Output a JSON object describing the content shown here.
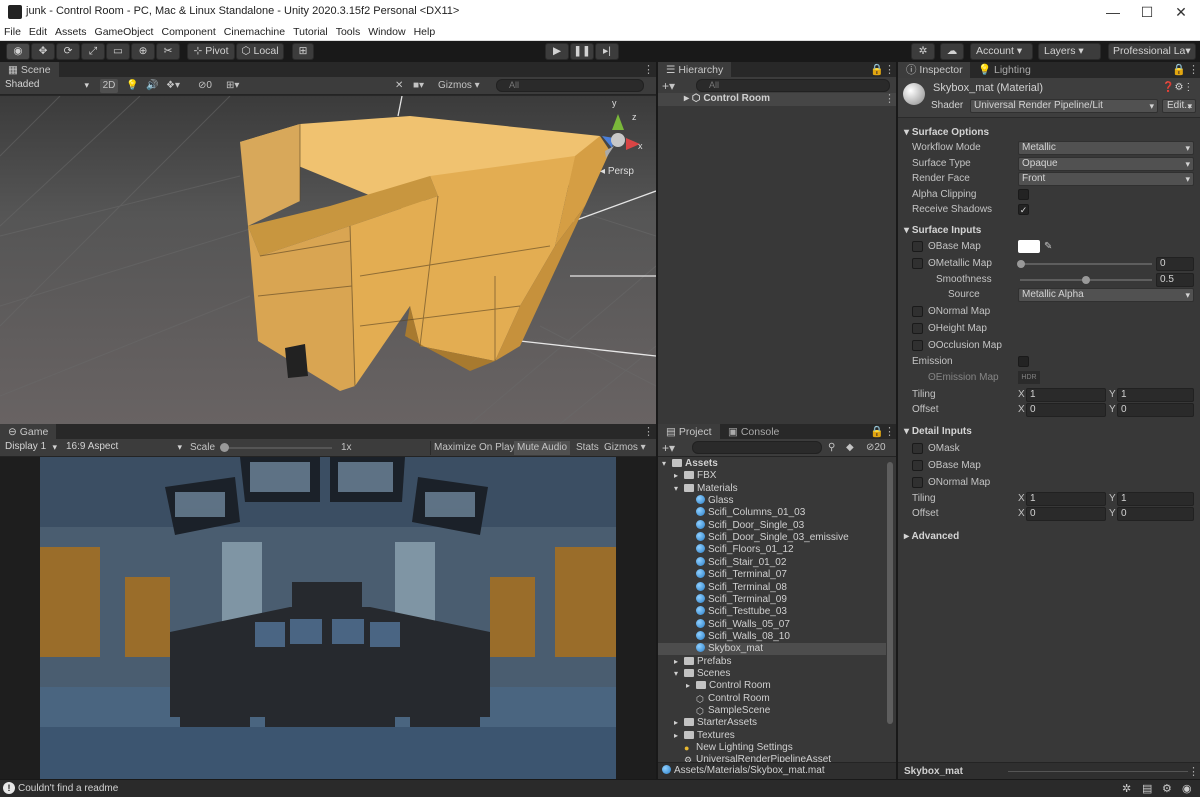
{
  "window": {
    "title": "junk - Control Room - PC, Mac & Linux Standalone - Unity 2020.3.15f2 Personal <DX11>",
    "minimize": "—",
    "maximize": "☐",
    "close": "✕"
  },
  "menu": [
    "File",
    "Edit",
    "Assets",
    "GameObject",
    "Component",
    "Cinemachine",
    "Tutorial",
    "Tools",
    "Window",
    "Help"
  ],
  "toolbar": {
    "pivot": "Pivot",
    "local": "Local",
    "account": "Account",
    "layers": "Layers",
    "layout": "Professional La▾"
  },
  "scene": {
    "tab": "Scene",
    "shading": "Shaded",
    "mode_2d": "2D",
    "hidden_count": "0",
    "gizmos": "Gizmos",
    "search_placeholder": "All",
    "persp": "Persp",
    "axis_y": "y",
    "axis_x": "x",
    "axis_z": "z"
  },
  "game": {
    "tab": "Game",
    "display": "Display 1",
    "aspect": "16:9 Aspect",
    "scale_label": "Scale",
    "scale_value": "1x",
    "maximize": "Maximize On Play",
    "mute": "Mute Audio",
    "stats": "Stats",
    "gizmos": "Gizmos"
  },
  "hierarchy": {
    "tab": "Hierarchy",
    "search_placeholder": "All",
    "root": "Control Room"
  },
  "project": {
    "tab": "Project",
    "console_tab": "Console",
    "hidden_count": "20",
    "items": [
      {
        "label": "Assets",
        "kind": "folder",
        "depth": 0,
        "open": true
      },
      {
        "label": "FBX",
        "kind": "folder",
        "depth": 1
      },
      {
        "label": "Materials",
        "kind": "folder",
        "depth": 1,
        "open": true
      },
      {
        "label": "Glass",
        "kind": "mat",
        "depth": 2
      },
      {
        "label": "Scifi_Columns_01_03",
        "kind": "mat",
        "depth": 2
      },
      {
        "label": "Scifi_Door_Single_03",
        "kind": "mat",
        "depth": 2
      },
      {
        "label": "Scifi_Door_Single_03_emissive",
        "kind": "mat",
        "depth": 2
      },
      {
        "label": "Scifi_Floors_01_12",
        "kind": "mat",
        "depth": 2
      },
      {
        "label": "Scifi_Stair_01_02",
        "kind": "mat",
        "depth": 2
      },
      {
        "label": "Scifi_Terminal_07",
        "kind": "mat",
        "depth": 2
      },
      {
        "label": "Scifi_Terminal_08",
        "kind": "mat",
        "depth": 2
      },
      {
        "label": "Scifi_Terminal_09",
        "kind": "mat",
        "depth": 2
      },
      {
        "label": "Scifi_Testtube_03",
        "kind": "mat",
        "depth": 2
      },
      {
        "label": "Scifi_Walls_05_07",
        "kind": "mat",
        "depth": 2
      },
      {
        "label": "Scifi_Walls_08_10",
        "kind": "mat",
        "depth": 2
      },
      {
        "label": "Skybox_mat",
        "kind": "mat",
        "depth": 2,
        "selected": true
      },
      {
        "label": "Prefabs",
        "kind": "folder",
        "depth": 1
      },
      {
        "label": "Scenes",
        "kind": "folder",
        "depth": 1,
        "open": true
      },
      {
        "label": "Control Room",
        "kind": "folder",
        "depth": 2
      },
      {
        "label": "Control Room",
        "kind": "unity",
        "depth": 2
      },
      {
        "label": "SampleScene",
        "kind": "unity",
        "depth": 2
      },
      {
        "label": "StarterAssets",
        "kind": "folder",
        "depth": 1
      },
      {
        "label": "Textures",
        "kind": "folder",
        "depth": 1
      },
      {
        "label": "New Lighting Settings",
        "kind": "light",
        "depth": 1
      },
      {
        "label": "UniversalRenderPipelineAsset",
        "kind": "asset",
        "depth": 1
      }
    ],
    "path": "Assets/Materials/Skybox_mat.mat"
  },
  "inspector": {
    "tab": "Inspector",
    "lighting_tab": "Lighting",
    "material_name": "Skybox_mat (Material)",
    "shader_label": "Shader",
    "shader": "Universal Render Pipeline/Lit",
    "edit": "Edit...",
    "surface_options": "Surface Options",
    "workflow_label": "Workflow Mode",
    "workflow": "Metallic",
    "surface_type_label": "Surface Type",
    "surface_type": "Opaque",
    "render_face_label": "Render Face",
    "render_face": "Front",
    "alpha_clipping": "Alpha Clipping",
    "receive_shadows": "Receive Shadows",
    "surface_inputs": "Surface Inputs",
    "base_map": "Base Map",
    "metallic_map": "Metallic Map",
    "metallic_value": "0",
    "smoothness": "Smoothness",
    "smoothness_value": "0.5",
    "smoothness_level": 0.5,
    "source_label": "Source",
    "source": "Metallic Alpha",
    "normal_map": "Normal Map",
    "height_map": "Height Map",
    "occlusion_map": "Occlusion Map",
    "emission": "Emission",
    "emission_map": "Emission Map",
    "hdr": "HDR",
    "tiling": "Tiling",
    "offset": "Offset",
    "x": "X",
    "y": "Y",
    "tiling_x": "1",
    "tiling_y": "1",
    "offset_x": "0",
    "offset_y": "0",
    "detail_inputs": "Detail Inputs",
    "mask": "Mask",
    "detail_base_map": "Base Map",
    "detail_normal_map": "Normal Map",
    "detail_tiling_x": "1",
    "detail_tiling_y": "1",
    "detail_offset_x": "0",
    "detail_offset_y": "0",
    "advanced": "Advanced",
    "footer": "Skybox_mat"
  },
  "status": {
    "message": "Couldn't find a readme"
  }
}
